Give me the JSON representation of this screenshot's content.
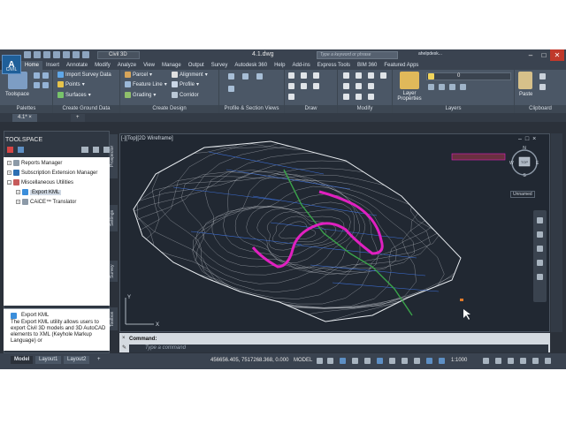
{
  "titlebar": {
    "app_logo": "A",
    "app_logo_sub": "CIVIL",
    "workspace": "Civil 3D",
    "file_title": "4.1.dwg",
    "search_placeholder": "Type a keyword or phrase",
    "user": "ahelpdesk..."
  },
  "ribbon_tabs": [
    "Home",
    "Insert",
    "Annotate",
    "Modify",
    "Analyze",
    "View",
    "Manage",
    "Output",
    "Survey",
    "Autodesk 360",
    "Help",
    "Add-ins",
    "Express Tools",
    "BIM 360",
    "Featured Apps"
  ],
  "ribbon": {
    "toolspace_label": "Toolspace",
    "palettes_title": "Palettes",
    "ground_data": {
      "items": [
        "Import Survey Data",
        "Points",
        "Surfaces"
      ],
      "title": "Create Ground Data"
    },
    "design": {
      "col1": [
        "Parcel",
        "Feature Line",
        "Grading"
      ],
      "col2": [
        "Alignment",
        "Profile",
        "Corridor"
      ],
      "title": "Create Design"
    },
    "profile_title": "Profile & Section Views",
    "draw_title": "Draw",
    "modify_title": "Modify",
    "layer_properties": "Layer Properties",
    "layers_title": "Layers",
    "layer_value": "0",
    "paste_label": "Paste",
    "clipboard_title": "Clipboard"
  },
  "doc_tab": "4.1*",
  "toolspace": {
    "title": "TOOLSPACE",
    "tree": [
      {
        "label": "Reports Manager"
      },
      {
        "label": "Subscription Extension Manager"
      },
      {
        "label": "Miscellaneous Utilities"
      },
      {
        "label": "Export KML"
      },
      {
        "label": "CAiCE™ Translator"
      }
    ],
    "info_title": "Export KML",
    "info_text": "The Export KML utility allows users to export Civil 3D models and 3D AutoCAD elements to XML (Keyhole Markup Language) or",
    "vtabs": [
      "Prospector",
      "Settings",
      "Survey",
      "Toolbox"
    ]
  },
  "drawing": {
    "view_label": "[-][Top][2D Wireframe]",
    "viewcube_top": "TOP",
    "compass": {
      "n": "N",
      "w": "W",
      "e": "E",
      "s": "S"
    },
    "ucs_name": "Unnamed",
    "ucs_y": "Y",
    "ucs_x": "X"
  },
  "command": {
    "history": "Command:",
    "placeholder": "Type a command"
  },
  "statusbar": {
    "layouts": [
      "Model",
      "Layout1",
      "Layout2"
    ],
    "coords": "456656.405, 7517268.368, 0.000",
    "space": "MODEL",
    "scale": "1:1000"
  },
  "colors": {
    "accent": "#1f5f99",
    "contour": "#d8dde3",
    "boundary": "#e8ecf0",
    "highlight": "#e020c0",
    "alignment": "#3aa34a",
    "section_lines": "#3d6fd6"
  }
}
